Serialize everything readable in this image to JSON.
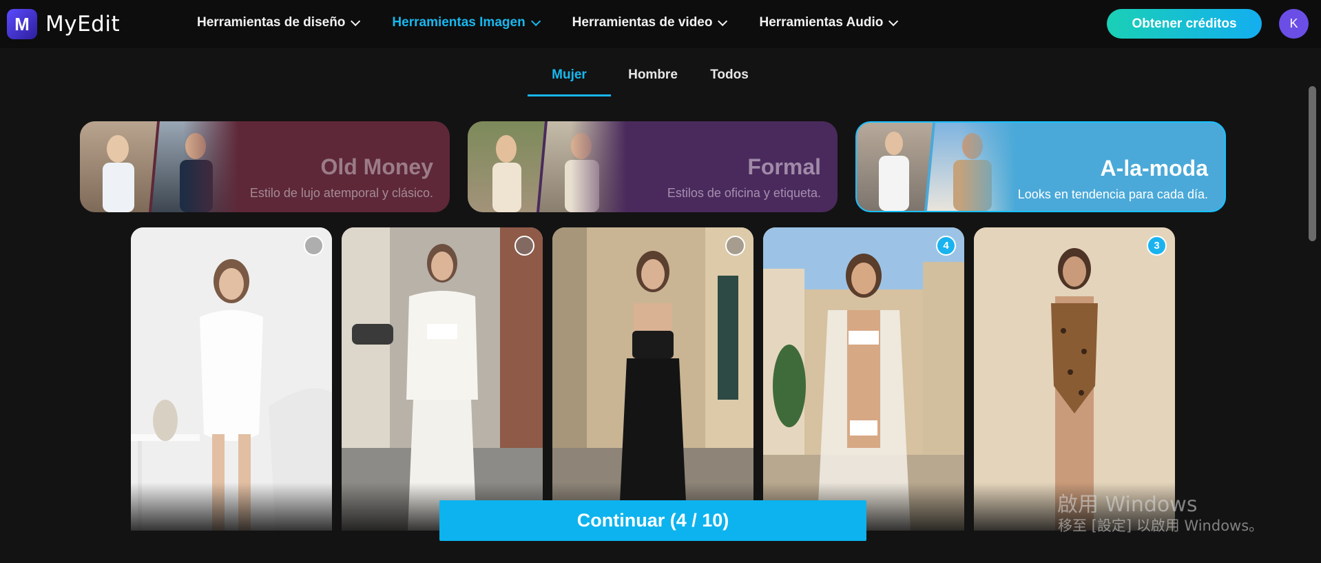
{
  "app": {
    "name": "MyEdit",
    "logo_letter": "M"
  },
  "nav": {
    "items": [
      {
        "label": "Herramientas de diseño",
        "active": false
      },
      {
        "label": "Herramientas Imagen",
        "active": true
      },
      {
        "label": "Herramientas de video",
        "active": false
      },
      {
        "label": "Herramientas Audio",
        "active": false
      }
    ],
    "credits_label": "Obtener créditos",
    "avatar_letter": "K"
  },
  "tabs": [
    {
      "label": "Mujer",
      "selected": true
    },
    {
      "label": "Hombre",
      "selected": false
    },
    {
      "label": "Todos",
      "selected": false
    }
  ],
  "styles": [
    {
      "title": "Old Money",
      "description": "Estilo de lujo atemporal y clásico.",
      "selected": false
    },
    {
      "title": "Formal",
      "description": "Estilos de oficina y etiqueta.",
      "selected": false
    },
    {
      "title": "A-la-moda",
      "description": "Looks en tendencia para cada día.",
      "selected": true
    }
  ],
  "models": [
    {
      "selection": ""
    },
    {
      "selection": ""
    },
    {
      "selection": ""
    },
    {
      "selection": "4"
    },
    {
      "selection": "3"
    }
  ],
  "continue_label": "Continuar (4 / 10)",
  "watermark": {
    "line1": "啟用 Windows",
    "line2": "移至 [設定] 以啟用 Windows。"
  },
  "colors": {
    "accent": "#18b8ef",
    "background": "#131313"
  }
}
